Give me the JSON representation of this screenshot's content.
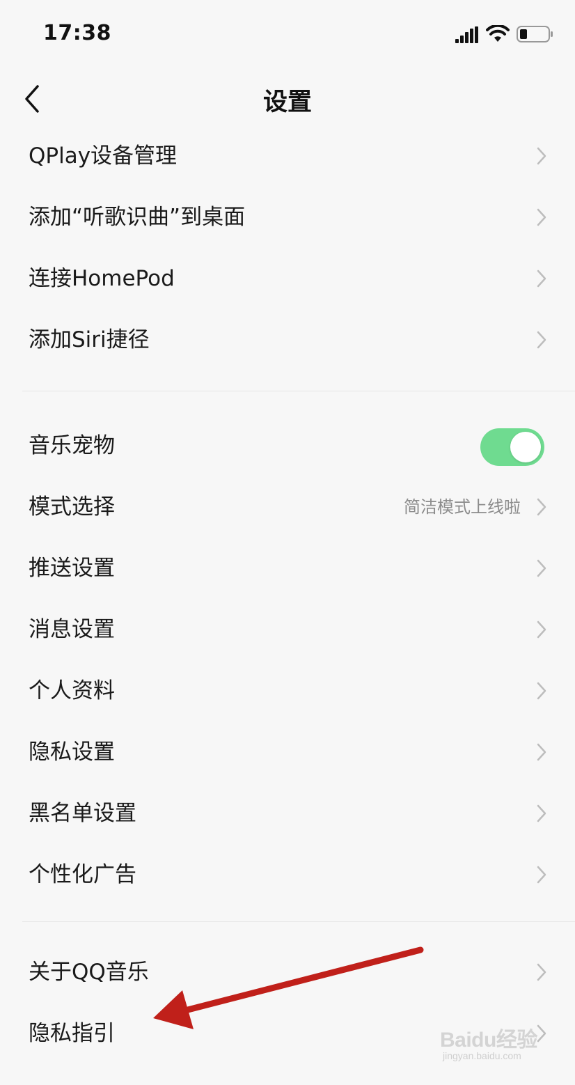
{
  "status_bar": {
    "time": "17:38",
    "icons": [
      "signal-icon",
      "wifi-icon",
      "battery-icon"
    ]
  },
  "nav": {
    "title": "设置",
    "back_icon": "chevron-left-icon"
  },
  "groups": [
    {
      "rows": [
        {
          "label": "QPlay设备管理"
        },
        {
          "label": "添加“听歌识曲”到桌面"
        },
        {
          "label": "连接HomePod"
        },
        {
          "label": "添加Siri捷径"
        }
      ]
    },
    {
      "rows": [
        {
          "label": "音乐宠物",
          "toggle_on": true
        },
        {
          "label": "模式选择",
          "value": "简洁模式上线啦"
        },
        {
          "label": "推送设置"
        },
        {
          "label": "消息设置"
        },
        {
          "label": "个人资料"
        },
        {
          "label": "隐私设置"
        },
        {
          "label": "黑名单设置"
        },
        {
          "label": "个性化广告"
        }
      ]
    },
    {
      "rows": [
        {
          "label": "关于QQ音乐"
        },
        {
          "label": "隐私指引"
        }
      ]
    }
  ],
  "colors": {
    "toggle_on": "#6fdb90",
    "background": "#f7f7f7",
    "annotation_arrow": "#c0201a"
  },
  "watermark": {
    "text": "Baidu经验",
    "sub": "jingyan.baidu.com"
  }
}
